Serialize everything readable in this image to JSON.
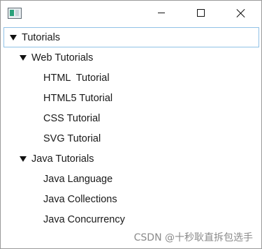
{
  "window": {
    "icon": "app-window-icon",
    "controls": {
      "minimize": "minimize-icon",
      "maximize": "maximize-icon",
      "close": "close-icon"
    }
  },
  "tree": {
    "root": {
      "label": "Tutorials",
      "expanded": true,
      "selected": true
    },
    "web": {
      "label": "Web Tutorials",
      "expanded": true,
      "items": [
        "HTML  Tutorial",
        "HTML5 Tutorial",
        "CSS Tutorial",
        "SVG Tutorial"
      ]
    },
    "java": {
      "label": "Java Tutorials",
      "expanded": true,
      "items": [
        "Java Language",
        "Java Collections",
        "Java Concurrency"
      ]
    }
  },
  "watermark": "CSDN @十秒耿直拆包选手"
}
